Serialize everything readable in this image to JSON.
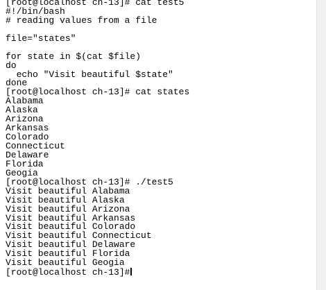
{
  "terminal": {
    "lines": [
      "[root@localhost ch-13]# cat test5",
      "#!/bin/bash",
      "# reading values from a file",
      "",
      "file=\"states\"",
      "",
      "for state in $(cat $file)",
      "do",
      "  echo \"Visit beautiful $state\"",
      "done",
      "[root@localhost ch-13]# cat states",
      "Alabama",
      "Alaska",
      "Arizona",
      "Arkansas",
      "Colorado",
      "Connecticut",
      "Delaware",
      "Florida",
      "Geogia",
      "[root@localhost ch-13]# ./test5",
      "Visit beautiful Alabama",
      "Visit beautiful Alaska",
      "Visit beautiful Arizona",
      "Visit beautiful Arkansas",
      "Visit beautiful Colorado",
      "Visit beautiful Connecticut",
      "Visit beautiful Delaware",
      "Visit beautiful Florida",
      "Visit beautiful Geogia",
      "[root@localhost ch-13]#"
    ]
  },
  "cursor_icon": "text-cursor-icon"
}
